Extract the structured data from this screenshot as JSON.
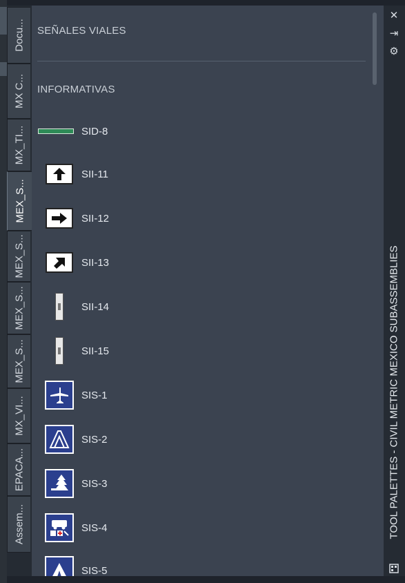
{
  "tabs": [
    {
      "label": "Docu..."
    },
    {
      "label": "MX C..."
    },
    {
      "label": "MX_TI..."
    },
    {
      "label": "MEX_S..."
    },
    {
      "label": "MEX_S..."
    },
    {
      "label": "MEX_S..."
    },
    {
      "label": "MEX_S..."
    },
    {
      "label": "MX_VI..."
    },
    {
      "label": "EPACA..."
    },
    {
      "label": "Assem..."
    }
  ],
  "active_tab_index": 3,
  "sections": [
    {
      "title": "SEÑALES VIALES"
    },
    {
      "title": "INFORMATIVAS"
    }
  ],
  "tools": [
    {
      "label": "SID-8",
      "icon": "green-guide-sign-icon"
    },
    {
      "label": "SII-11",
      "icon": "arrow-up-sign-icon"
    },
    {
      "label": "SII-12",
      "icon": "arrow-right-sign-icon"
    },
    {
      "label": "SII-13",
      "icon": "arrow-diagonal-sign-icon"
    },
    {
      "label": "SII-14",
      "icon": "post-sign-icon"
    },
    {
      "label": "SII-15",
      "icon": "post-sign-icon"
    },
    {
      "label": "SIS-1",
      "icon": "airport-sign-icon"
    },
    {
      "label": "SIS-2",
      "icon": "tunnel-sign-icon"
    },
    {
      "label": "SIS-3",
      "icon": "forest-sign-icon"
    },
    {
      "label": "SIS-4",
      "icon": "ambulance-sign-icon"
    },
    {
      "label": "SIS-5",
      "icon": "camping-sign-icon"
    }
  ],
  "palette_title": "TOOL PALETTES - CIVIL METRIC MEXICO SUBASSEMBLIES",
  "window_controls": {
    "close": "✕",
    "autohide": "⇥",
    "properties": "⚙"
  },
  "colors": {
    "panel": "#3b4350",
    "tab": "#3b434d",
    "sign_blue": "#2b3f8e",
    "sign_green": "#2e8b57"
  }
}
